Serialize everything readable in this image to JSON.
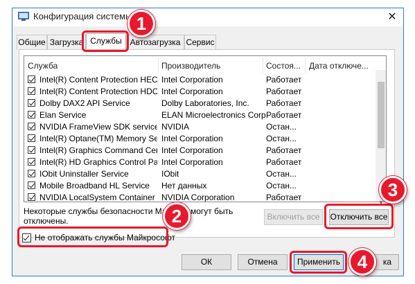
{
  "window": {
    "title": "Конфигурация системы",
    "close_glyph": "✕"
  },
  "tabs": [
    "Общие",
    "Загрузка",
    "Службы",
    "Автозагрузка",
    "Сервис"
  ],
  "columns": [
    "Служба",
    "Производитель",
    "Состоя...",
    "Дата отключе..."
  ],
  "services": [
    {
      "name": "Intel(R) Content Protection HEC...",
      "maker": "Intel Corporation",
      "status": "Работает"
    },
    {
      "name": "Intel(R) Content Protection HDC...",
      "maker": "Intel Corporation",
      "status": "Работает"
    },
    {
      "name": "Dolby DAX2 API Service",
      "maker": "Dolby Laboratories, Inc.",
      "status": "Работает"
    },
    {
      "name": "Elan Service",
      "maker": "ELAN Microelectronics Corp.",
      "status": "Работает"
    },
    {
      "name": "NVIDIA FrameView SDK service",
      "maker": "NVIDIA",
      "status": "Остан..."
    },
    {
      "name": "Intel(R) Optane(TM) Memory Se...",
      "maker": "Intel Corporation",
      "status": "Остан..."
    },
    {
      "name": "Intel(R) Graphics Command Cen...",
      "maker": "Intel Corporation",
      "status": "Работает"
    },
    {
      "name": "Intel(R) HD Graphics Control Pa...",
      "maker": "Intel Corporation",
      "status": "Работает"
    },
    {
      "name": "IObit Uninstaller Service",
      "maker": "IObit",
      "status": "Остан..."
    },
    {
      "name": "Mobile Broadband HL Service",
      "maker": "Нет данных",
      "status": "Остан..."
    },
    {
      "name": "NVIDIA LocalSystem Container",
      "maker": "NVIDIA Corporation",
      "status": "Работает"
    }
  ],
  "note_line1": "Некоторые службы безопасности Майк",
  "note_line1_tail": "е могут быть",
  "note_line2": "отключены.",
  "hide_ms_label": "Не отображать службы Майкрософт",
  "buttons": {
    "enable_all": "Включить все",
    "disable_all": "Отключить все",
    "ok": "ОК",
    "cancel": "Отмена",
    "apply": "Применить",
    "help_tail": "ка"
  },
  "badges": [
    "1",
    "2",
    "3",
    "4"
  ],
  "colors": {
    "highlight": "#e8192c",
    "accent": "#0078d7"
  }
}
